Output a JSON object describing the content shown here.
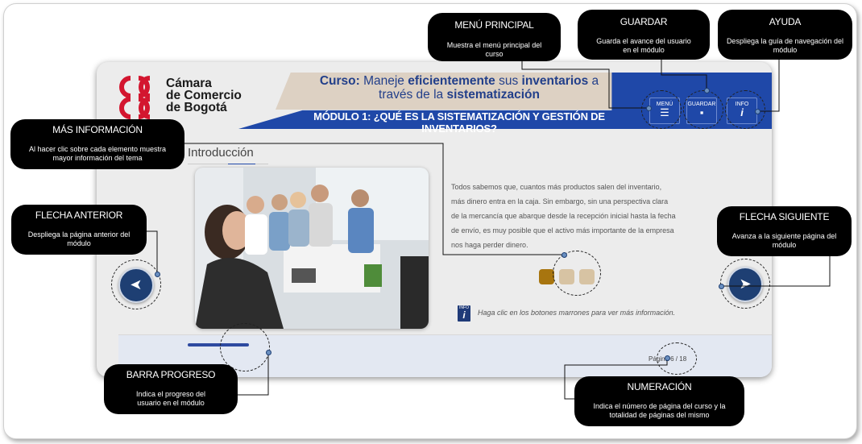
{
  "logo": {
    "line1": "Cámara",
    "line2": "de Comercio",
    "line3": "de Bogotá"
  },
  "course": {
    "prefix": "Curso:",
    "w1": "Maneje",
    "w2": "eficientemente",
    "w3": "sus",
    "w4": "inventarios",
    "w5": "a",
    "line2a": "través de la",
    "line2b": "sistematización",
    "module": "MÓDULO 1: ¿QUÉ ES LA SISTEMATIZACIÓN Y GESTIÓN DE INVENTARIOS?"
  },
  "header_buttons": {
    "menu": "MENÚ",
    "save": "GUARDAR",
    "info": "INFO"
  },
  "section": {
    "title": "Introducción"
  },
  "content": {
    "body": "Todos sabemos que, cuantos más productos salen del inventario, más dinero entra en la caja. Sin embargo, sin una perspectiva clara de la mercancía que abarque desde la recepción inicial hasta la fecha de envío, es muy posible que el activo más importante de la empresa nos haga perder dinero.",
    "hint": "Haga clic en los botones marrones para ver más información.",
    "hint_icon_label": "INFO",
    "hint_icon_glyph": "i"
  },
  "info_buttons": [
    {
      "color": "#a8750f"
    },
    {
      "color": "#d7c3a3"
    },
    {
      "color": "#d7c3a3"
    }
  ],
  "footer": {
    "page": "Página 6 / 18",
    "progress_fraction": 0.33
  },
  "nav": {
    "prev_glyph": "➤",
    "next_glyph": "➤"
  },
  "callouts": {
    "menu": {
      "title": "MENÚ PRINCIPAL",
      "desc": "Muestra el menú principal del curso"
    },
    "save": {
      "title": "GUARDAR",
      "desc": "Guarda el avance del usuario en el módulo"
    },
    "help": {
      "title": "AYUDA",
      "desc": "Despliega la guía de navegación del módulo"
    },
    "more": {
      "title": "MÁS INFORMACIÓN",
      "desc": "Al hacer clic sobre cada elemento muestra mayor información del tema"
    },
    "prev": {
      "title": "FLECHA ANTERIOR",
      "desc": "Despliega la página anterior del módulo"
    },
    "next": {
      "title": "FLECHA SIGUIENTE",
      "desc": "Avanza a la siguiente página del módulo"
    },
    "progress": {
      "title": "BARRA PROGRESO",
      "desc": "Indica el progreso del usuario en el módulo"
    },
    "numbering": {
      "title": "NUMERACIÓN",
      "desc": "Indica el número de página del curso y la totalidad de páginas del mismo"
    }
  },
  "colors": {
    "brand_red": "#d3162f",
    "brand_blue": "#1f48a8",
    "beige": "#ddd1c3",
    "nav_blue": "#1e3f73"
  }
}
